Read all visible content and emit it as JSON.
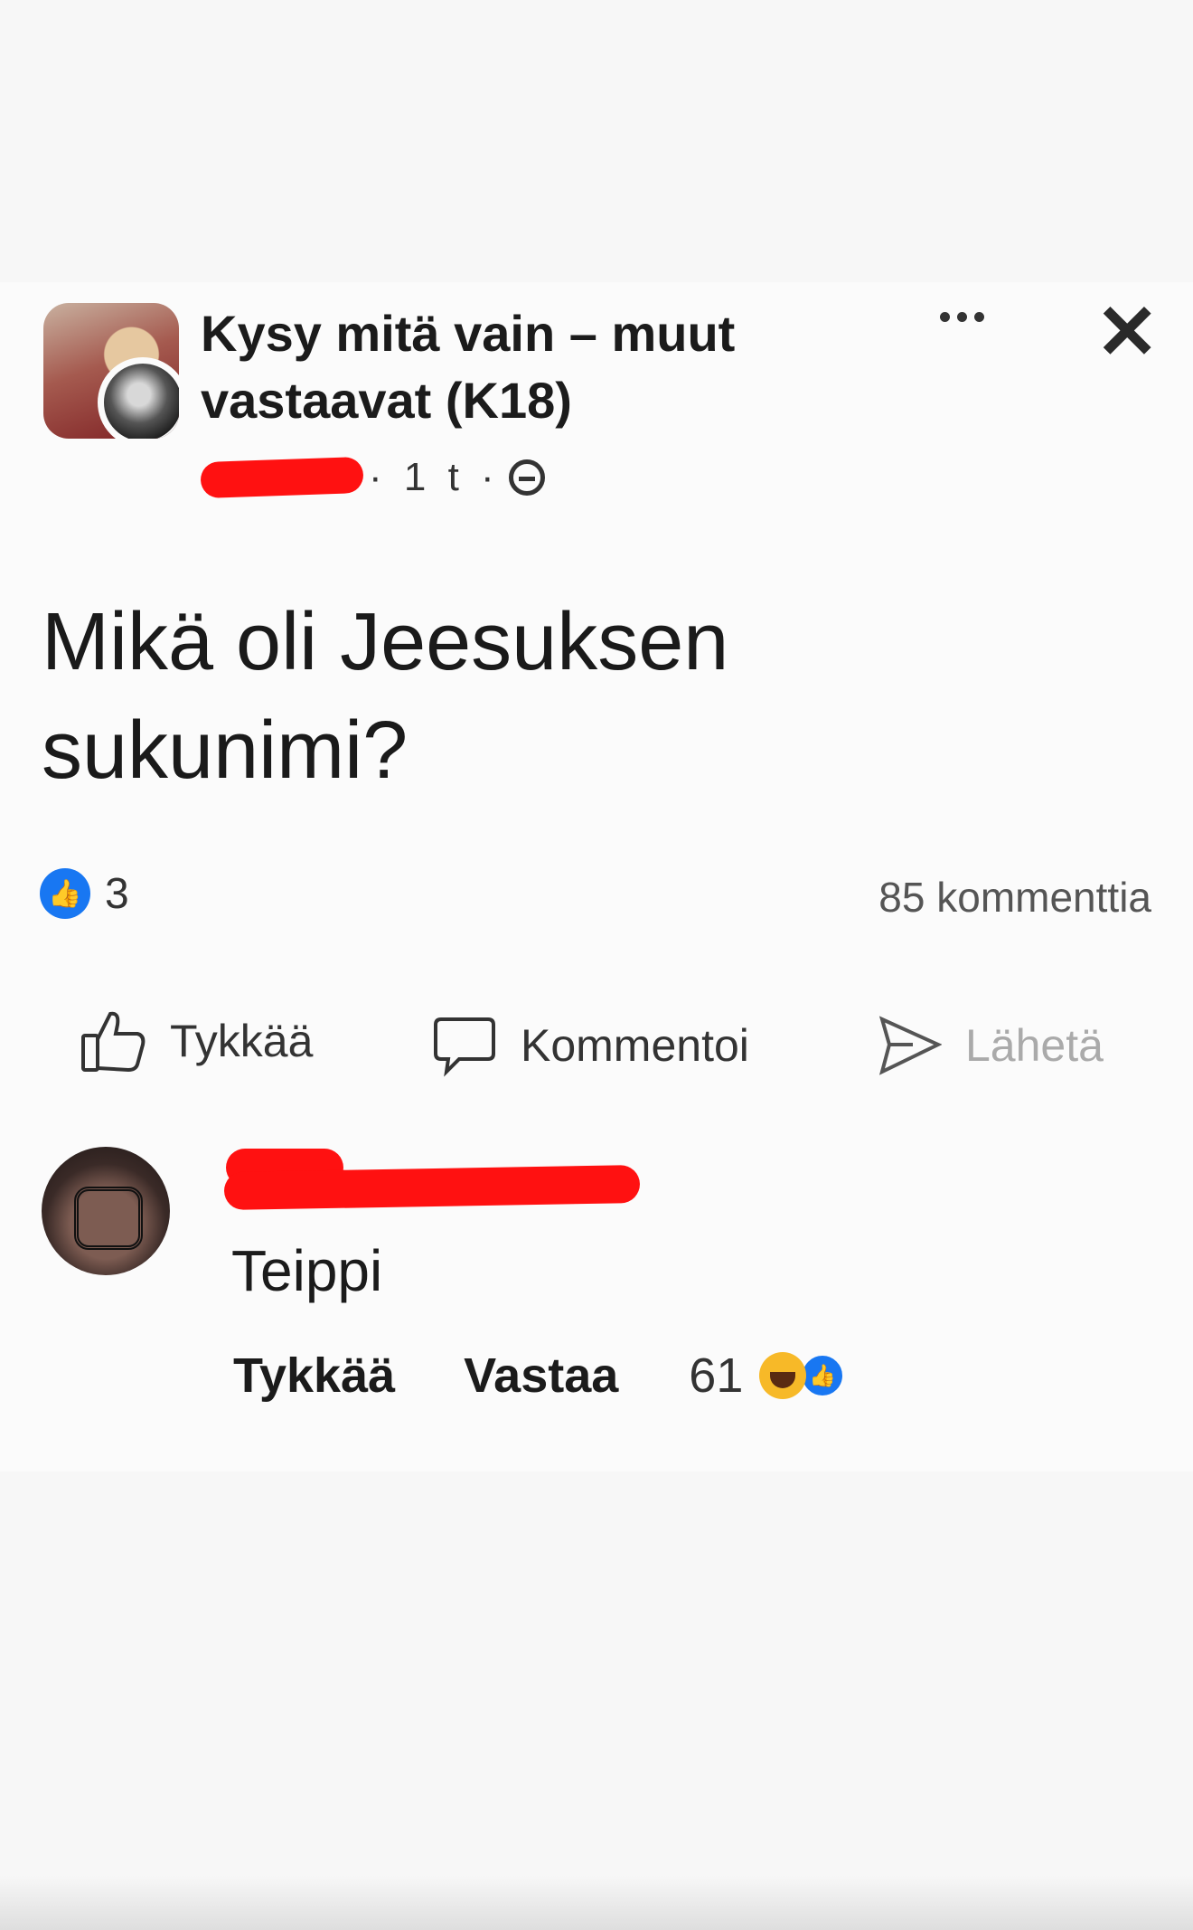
{
  "post": {
    "group_name": "Kysy mitä vain – muut vastaavat  (K18)",
    "time_text": "· 1 t ·",
    "body": "Mikä oli Jeesuksen sukunimi?",
    "like_count": "3",
    "comment_count": "85 kommenttia"
  },
  "actions": {
    "like": "Tykkää",
    "comment": "Kommentoi",
    "send": "Lähetä"
  },
  "comment": {
    "text": "Teippi",
    "like": "Tykkää",
    "reply": "Vastaa",
    "reaction_count": "61"
  },
  "icons": {
    "more": "more-dots-icon",
    "close": "close-icon",
    "privacy": "group-privacy-icon",
    "like_badge": "like-badge-icon",
    "thumbs_up": "thumbs-up-icon",
    "speech_bubble": "comment-bubble-icon",
    "send": "send-arrow-icon",
    "haha": "haha-reaction-icon"
  },
  "colors": {
    "accent": "#1877f2",
    "redaction": "#ff1111",
    "haha": "#f7b928"
  }
}
